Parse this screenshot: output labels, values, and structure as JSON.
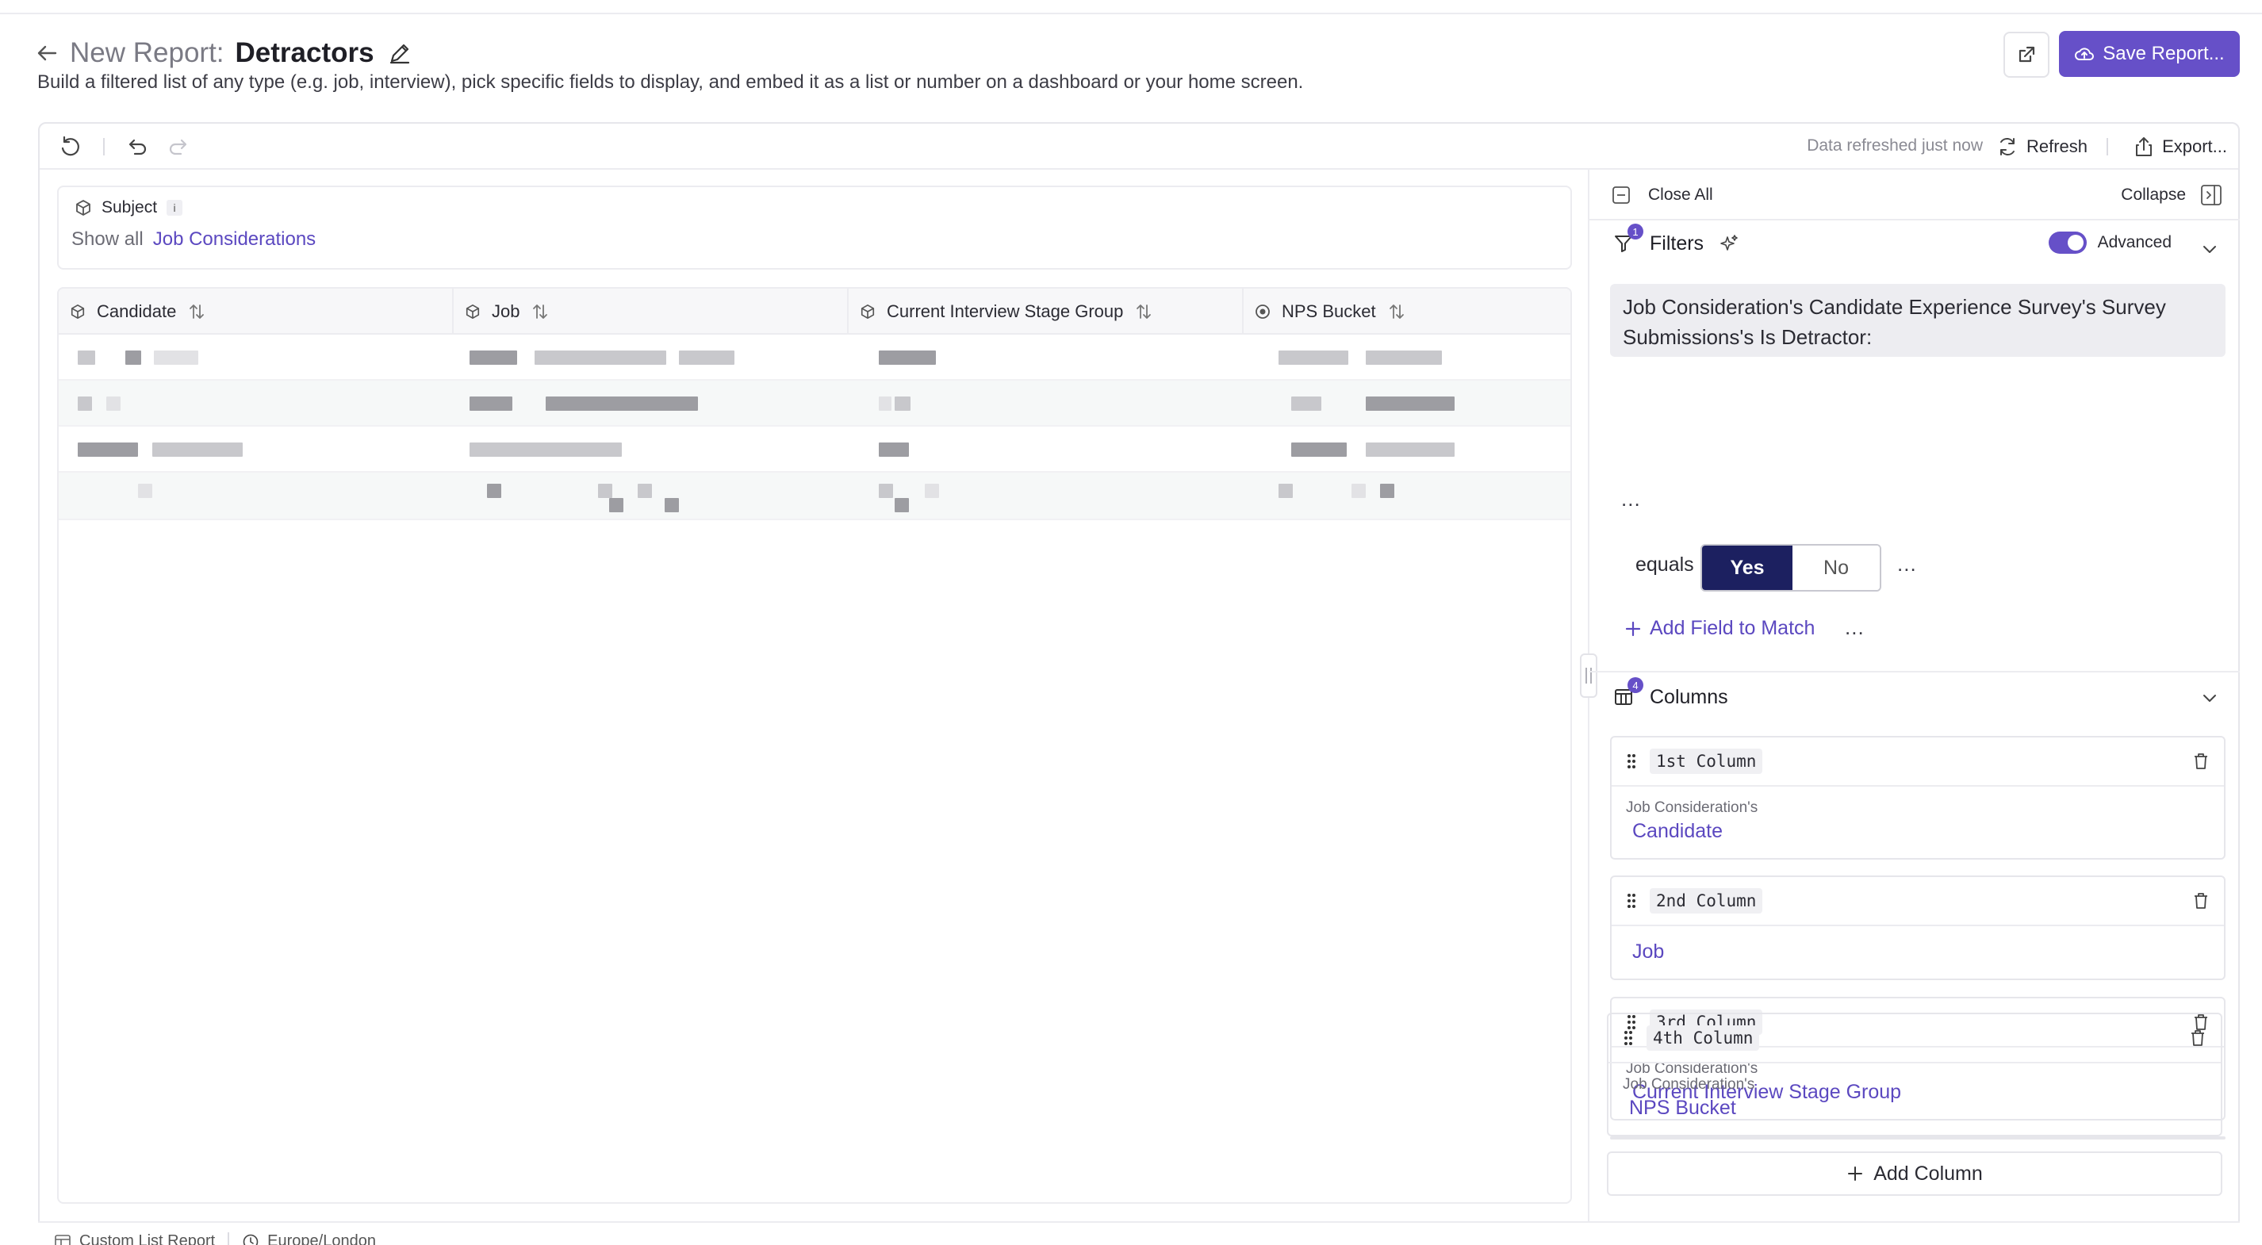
{
  "header": {
    "title_prefix": "New Report:",
    "title_name": "Detractors",
    "description": "Build a filtered list of any type (e.g. job, interview), pick specific fields to display, and embed it as a list or number on a dashboard or your home screen.",
    "save_label": "Save Report...",
    "accent_color": "#6650c8"
  },
  "toolbar": {
    "status": "Data refreshed just now",
    "refresh_label": "Refresh",
    "export_label": "Export..."
  },
  "subject": {
    "label": "Subject",
    "info": "i",
    "show_all": "Show all",
    "type_link": "Job Considerations"
  },
  "table": {
    "columns": [
      {
        "label": "Candidate",
        "icon": "cube-icon"
      },
      {
        "label": "Job",
        "icon": "cube-icon"
      },
      {
        "label": "Current Interview Stage Group",
        "icon": "cube-icon"
      },
      {
        "label": "NPS Bucket",
        "icon": "radio-icon"
      }
    ],
    "row_count": 4
  },
  "panel": {
    "close_all": "Close All",
    "collapse": "Collapse",
    "filters": {
      "label": "Filters",
      "count": "1",
      "advanced_label": "Advanced",
      "advanced_on": true,
      "field_text": "Job Consideration's Candidate Experience Survey's Survey Submissions's Is Detractor:",
      "more": "...",
      "equals_label": "equals",
      "yes_label": "Yes",
      "no_label": "No",
      "selected": "Yes",
      "add_match_label": "Add Field to Match"
    },
    "columns": {
      "label": "Columns",
      "count": "4",
      "items": [
        {
          "name": "1st Column",
          "prefix": "Job Consideration's",
          "field": "Candidate"
        },
        {
          "name": "2nd Column",
          "prefix": "",
          "field": "Job"
        },
        {
          "name": "3rd Column",
          "prefix": "Job Consideration's",
          "field": "Current Interview Stage Group"
        },
        {
          "name": "4th Column",
          "prefix": "Job Consideration's",
          "field": "NPS Bucket"
        }
      ],
      "add_label": "Add Column"
    }
  },
  "footer": {
    "report_type": "Custom List Report",
    "timezone": "Europe/London"
  }
}
